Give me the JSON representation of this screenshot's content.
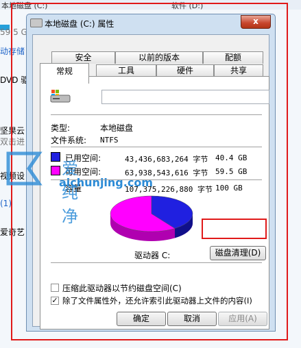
{
  "background": {
    "title_left": "本地磁盘 (C:)",
    "title_right": "软件 (D:)",
    "items": [
      "59.5 G",
      "动存储",
      "DVD 驱",
      "坚果云",
      "双击进",
      "视频设",
      "(1)",
      "爱奇艺"
    ]
  },
  "dialog": {
    "title": "本地磁盘 (C:) 属性",
    "close_label": "x",
    "tabs_row1": [
      "安全",
      "以前的版本",
      "配额"
    ],
    "tabs_row2": [
      "常规",
      "工具",
      "硬件",
      "共享"
    ],
    "general": {
      "name_value": "",
      "type_label": "类型:",
      "type_value": "本地磁盘",
      "fs_label": "文件系统:",
      "fs_value": "NTFS",
      "used_label": "已用空间:",
      "used_bytes": "43,436,683,264 字节",
      "used_gb": "40.4 GB",
      "free_label": "可用空间:",
      "free_bytes": "63,938,543,616 字节",
      "free_gb": "59.5 GB",
      "capacity_label": "容量",
      "capacity_bytes": "107,375,226,880 字节",
      "capacity_gb": "100 GB",
      "drive_label": "驱动器 C:",
      "cleanup_button": "磁盘清理(D)",
      "compress_label": "压缩此驱动器以节约磁盘空间(C)",
      "index_label": "除了文件属性外，还允许索引此驱动器上文件的内容(I)",
      "compress_checked": false,
      "index_checked": true
    },
    "buttons": {
      "ok": "确定",
      "cancel": "取消",
      "apply": "应用(A)"
    }
  },
  "usage": {
    "used_fraction": 0.404,
    "used_color": "#2020e0",
    "free_color": "#ff00ff"
  },
  "watermark": {
    "text": "爱纯净",
    "url": "aichunjing.com"
  }
}
